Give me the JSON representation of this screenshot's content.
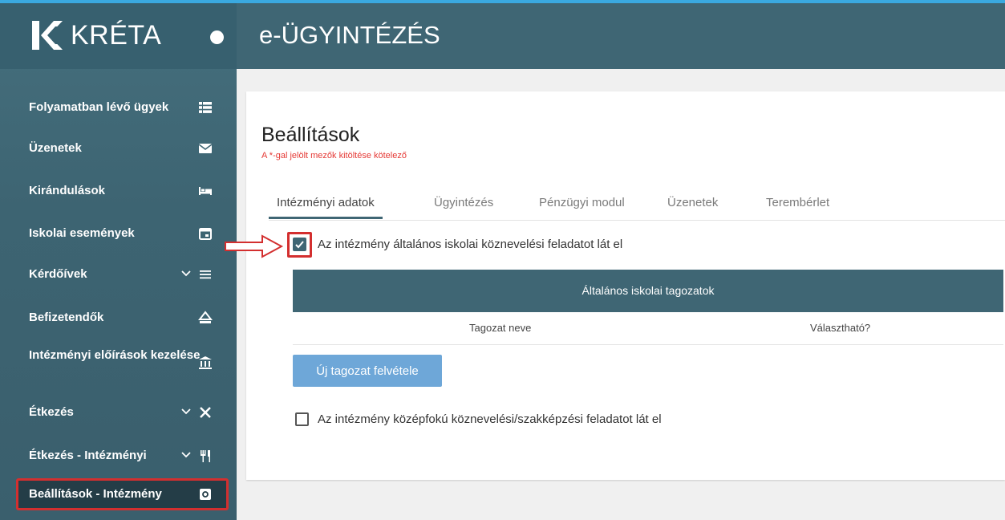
{
  "brand": {
    "name": "KRÉTA"
  },
  "header": {
    "title": "e-ÜGYINTÉZÉS"
  },
  "sidebar": {
    "items": [
      {
        "label": "Folyamatban lévő ügyek",
        "icon": "list-icon"
      },
      {
        "label": "Üzenetek",
        "icon": "envelope-icon"
      },
      {
        "label": "Kirándulások",
        "icon": "bed-icon"
      },
      {
        "label": "Iskolai események",
        "icon": "calendar-icon"
      },
      {
        "label": "Kérdőívek",
        "icon": "menu-lines-icon",
        "expandable": true
      },
      {
        "label": "Befizetendők",
        "icon": "scale-icon"
      },
      {
        "label": "Intézményi előírások kezelése",
        "icon": "institution-icon"
      },
      {
        "label": "Étkezés",
        "icon": "utensils-cross-icon",
        "expandable": true
      },
      {
        "label": "Étkezés - Intézményi",
        "icon": "fork-knife-icon",
        "expandable": true
      },
      {
        "label": "Beállítások - Intézmény",
        "icon": "settings-icon",
        "active": true
      }
    ]
  },
  "page": {
    "title": "Beállítások",
    "required_note": "A *-gal jelölt mezők kitöltése kötelező",
    "tabs": [
      "Intézményi adatok",
      "Ügyintézés",
      "Pénzügyi modul",
      "Üzenetek",
      "Terembérlet"
    ],
    "active_tab": "Intézményi adatok",
    "checkbox_primary": {
      "label": "Az intézmény általános iskolai köznevelési feladatot lát el",
      "checked": true
    },
    "table": {
      "title": "Általános iskolai tagozatok",
      "columns": [
        "Tagozat neve",
        "Választható?"
      ]
    },
    "new_button": "Új tagozat felvétele",
    "checkbox_secondary": {
      "label": "Az intézmény középfokú köznevelési/szakképzési feladatot lát el",
      "checked": false
    }
  },
  "colors": {
    "primary": "#3f6674",
    "accent": "#3aa9e0",
    "highlight": "#d32f2f",
    "button": "#6ea7d8"
  }
}
